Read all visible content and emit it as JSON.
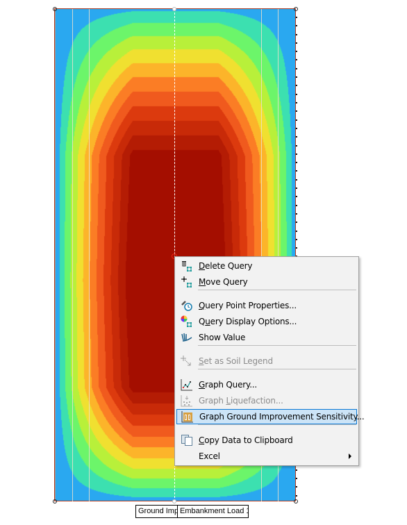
{
  "canvas_labels": {
    "left_label": "Ground Imp",
    "right_label": "Embankment Load 1"
  },
  "contour_colors": [
    "#2aa8f0",
    "#3ce0b0",
    "#6cf56a",
    "#b8f03a",
    "#f0e030",
    "#fcb42a",
    "#fb7d25",
    "#f05a1e",
    "#dc3a0e",
    "#c82a08",
    "#b41c04",
    "#a40e00"
  ],
  "context_menu": {
    "items": [
      {
        "label_pre": "",
        "label_ul": "D",
        "label_post": "elete Query",
        "icon": "delete-query-icon",
        "disabled": false
      },
      {
        "label_pre": "",
        "label_ul": "M",
        "label_post": "ove Query",
        "icon": "move-query-icon",
        "disabled": false
      },
      {
        "label_pre": "",
        "label_ul": "Q",
        "label_post": "uery Point Properties...",
        "icon": "query-point-properties-icon",
        "disabled": false
      },
      {
        "label_pre": "Q",
        "label_ul": "u",
        "label_post": "ery Display Options...",
        "icon": "color-wheel-icon",
        "disabled": false
      },
      {
        "label_pre": "Show Value",
        "label_ul": "",
        "label_post": "",
        "icon": "show-value-icon",
        "disabled": false
      },
      {
        "label_pre": "",
        "label_ul": "S",
        "label_post": "et as Soil Legend",
        "icon": "soil-legend-icon",
        "disabled": true
      },
      {
        "label_pre": "",
        "label_ul": "G",
        "label_post": "raph Query...",
        "icon": "graph-query-icon",
        "disabled": false
      },
      {
        "label_pre": "Graph ",
        "label_ul": "L",
        "label_post": "iquefaction...",
        "icon": "graph-liquefaction-icon",
        "disabled": true
      },
      {
        "label_pre": "Graph Ground Improvement Sensitivity...",
        "label_ul": "",
        "label_post": "",
        "icon": "sensitivity-chart-icon",
        "disabled": false,
        "highlighted": true
      },
      {
        "label_pre": "",
        "label_ul": "C",
        "label_post": "opy Data to Clipboard",
        "icon": "copy-icon",
        "disabled": false
      },
      {
        "label_pre": "Excel",
        "label_ul": "",
        "label_post": "",
        "icon": "",
        "disabled": false,
        "submenu": true
      }
    ]
  }
}
